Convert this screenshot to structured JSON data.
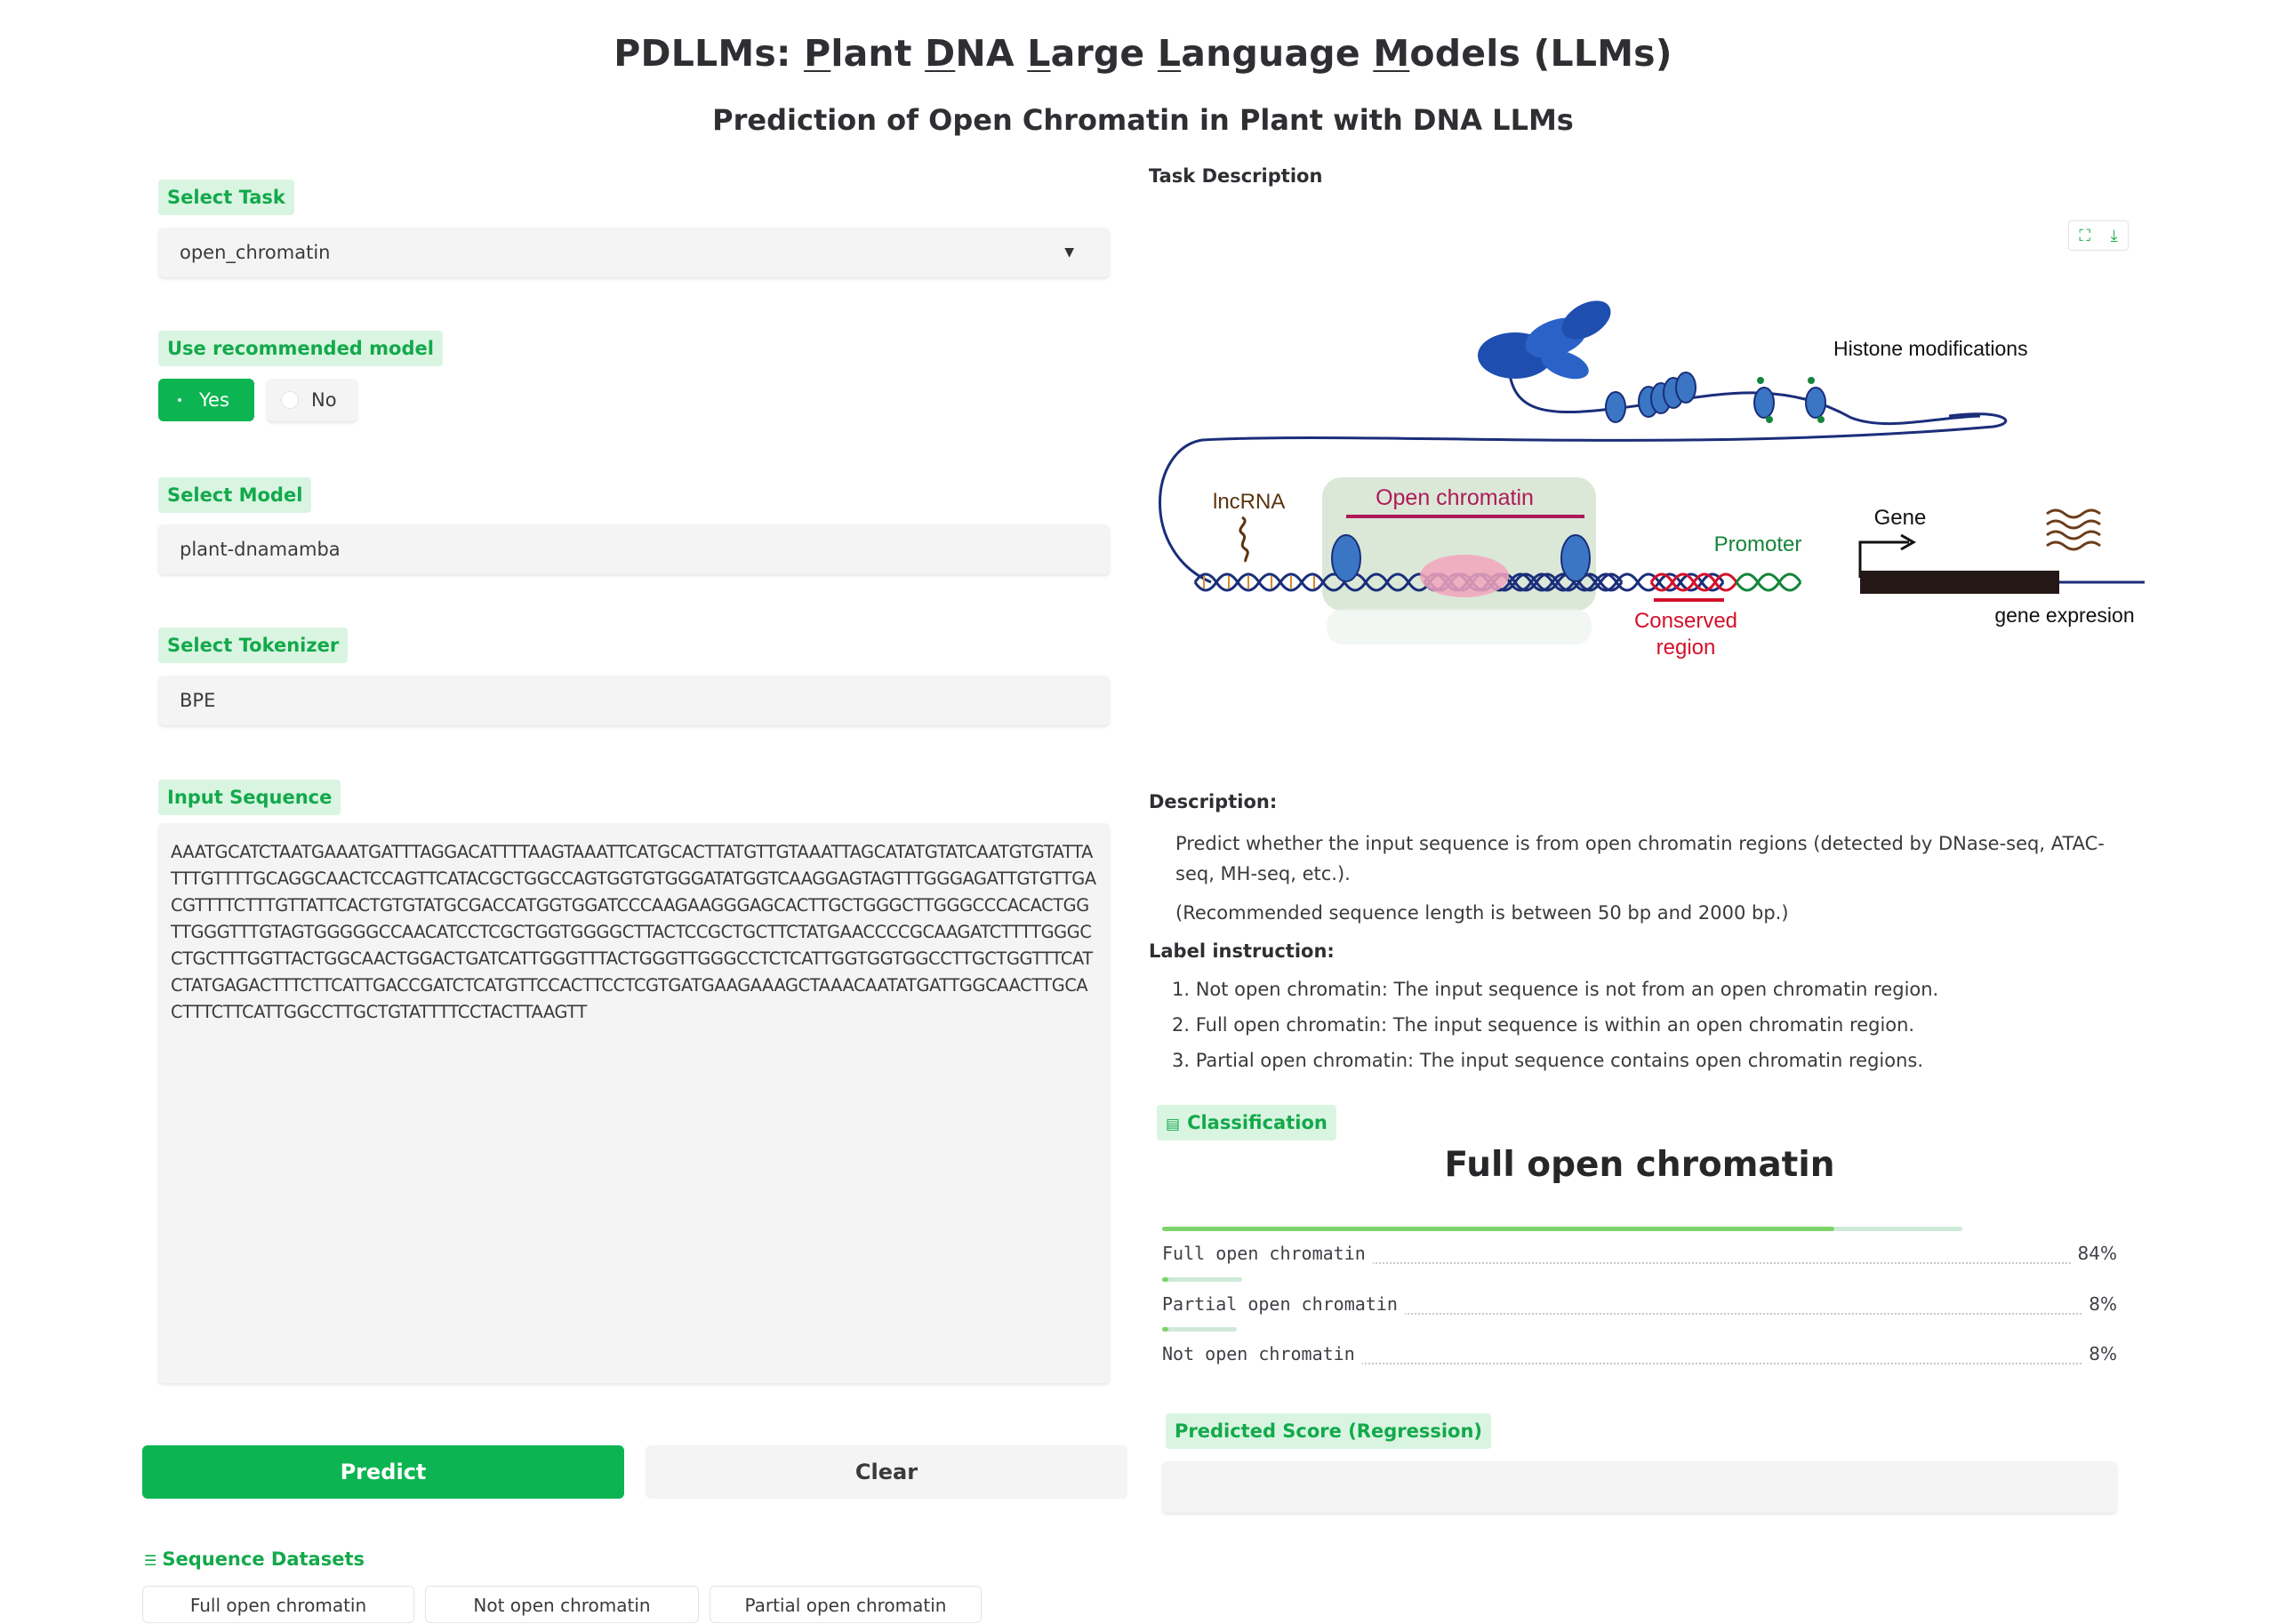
{
  "header": {
    "title_parts": [
      "PDLLMs: ",
      "P",
      "lant ",
      "D",
      "NA ",
      "L",
      "arge ",
      "L",
      "anguage ",
      "M",
      "odels (LLMs)"
    ],
    "subtitle": "Prediction of Open Chromatin in Plant with DNA LLMs"
  },
  "left": {
    "task_label": "Select Task",
    "task_value": "open_chromatin",
    "recommend_label": "Use recommended model",
    "radio_yes": "Yes",
    "radio_no": "No",
    "radio_selected": "Yes",
    "model_label": "Select Model",
    "model_value": "plant-dnamamba",
    "tokenizer_label": "Select Tokenizer",
    "tokenizer_value": "BPE",
    "input_label": "Input Sequence",
    "input_value": "AAATGCATCTAATGAAATGATTTAGGACATTTTAAGTAAATTCATGCACTTATGTTGTAAATTAGCATATGTATCAATGTGTATTATTTGTTTTGCAGGCAACTCCAGTTCATACGCTGGCCAGTGGTGTGGGATATGGTCAAGGAGTAGTTTGGGAGATTGTGTTGACGTTTTCTTTGTTATTCACTGTGTATGCGACCATGGTGGATCCCAAGAAGGGAGCACTTGCTGGGCTTGGGCCCACACTGGTTGGGTTTGTAGTGGGGGCCAACATCCTCGCTGGTGGGGCTTACTCCGCTGCTTCTATGAACCCCGCAAGATCTTTTGGGCCTGCTTTGGTTACTGGCAACTGGACTGATCATTGGGTTTACTGGGTTGGGCCTCTCATTGGTGGTGGCCTTGCTGGTTTCATCTATGAGACTTTCTTCATTGACCGATCTCATGTTCCACTTCCTCGTGATGAAGAAAGCTAAACAATATGATTGGCAACTTGCACTTTCTTCATTGGCCTTGCTGTATTTTCCTACTTAAGTT",
    "predict_label": "Predict",
    "clear_label": "Clear",
    "datasets_label": "Sequence Datasets",
    "datasets": [
      "Full open chromatin",
      "Not open chromatin",
      "Partial open chromatin"
    ]
  },
  "right": {
    "task_desc_label": "Task Description",
    "figure": {
      "histone": "Histone modifications",
      "lncrna": "lncRNA",
      "open_chromatin": "Open chromatin",
      "gene": "Gene",
      "promoter": "Promoter",
      "conserved_1": "Conserved",
      "conserved_2": "region",
      "gene_expression": "gene expresion"
    },
    "description_title": "Description:",
    "description_1": "Predict whether the input sequence is from open chromatin regions (detected by DNase-seq, ATAC-seq, MH-seq, etc.).",
    "description_2": "(Recommended sequence length is between 50 bp and 2000 bp.)",
    "label_title": "Label instruction:",
    "labels": [
      "1. Not open chromatin: The input sequence is not from an open chromatin region.",
      "2. Full open chromatin: The input sequence is within an open chromatin region.",
      "3. Partial open chromatin: The input sequence contains open chromatin regions."
    ],
    "classification_label": "Classification",
    "classification_result": "Full open chromatin",
    "predictions": [
      {
        "label": "Full open chromatin",
        "pct": "84%",
        "value": 0.84
      },
      {
        "label": "Partial open chromatin",
        "pct": "8%",
        "value": 0.08
      },
      {
        "label": "Not open chromatin",
        "pct": "8%",
        "value": 0.08
      }
    ],
    "score_label": "Predicted Score (Regression)",
    "score_value": ""
  },
  "colors": {
    "accent": "#0cb552",
    "tag_bg": "#d9f5e2",
    "tag_text": "#13a94a",
    "navy": "#1a2e7a",
    "red": "#d4102a",
    "green_text": "#14853a"
  }
}
